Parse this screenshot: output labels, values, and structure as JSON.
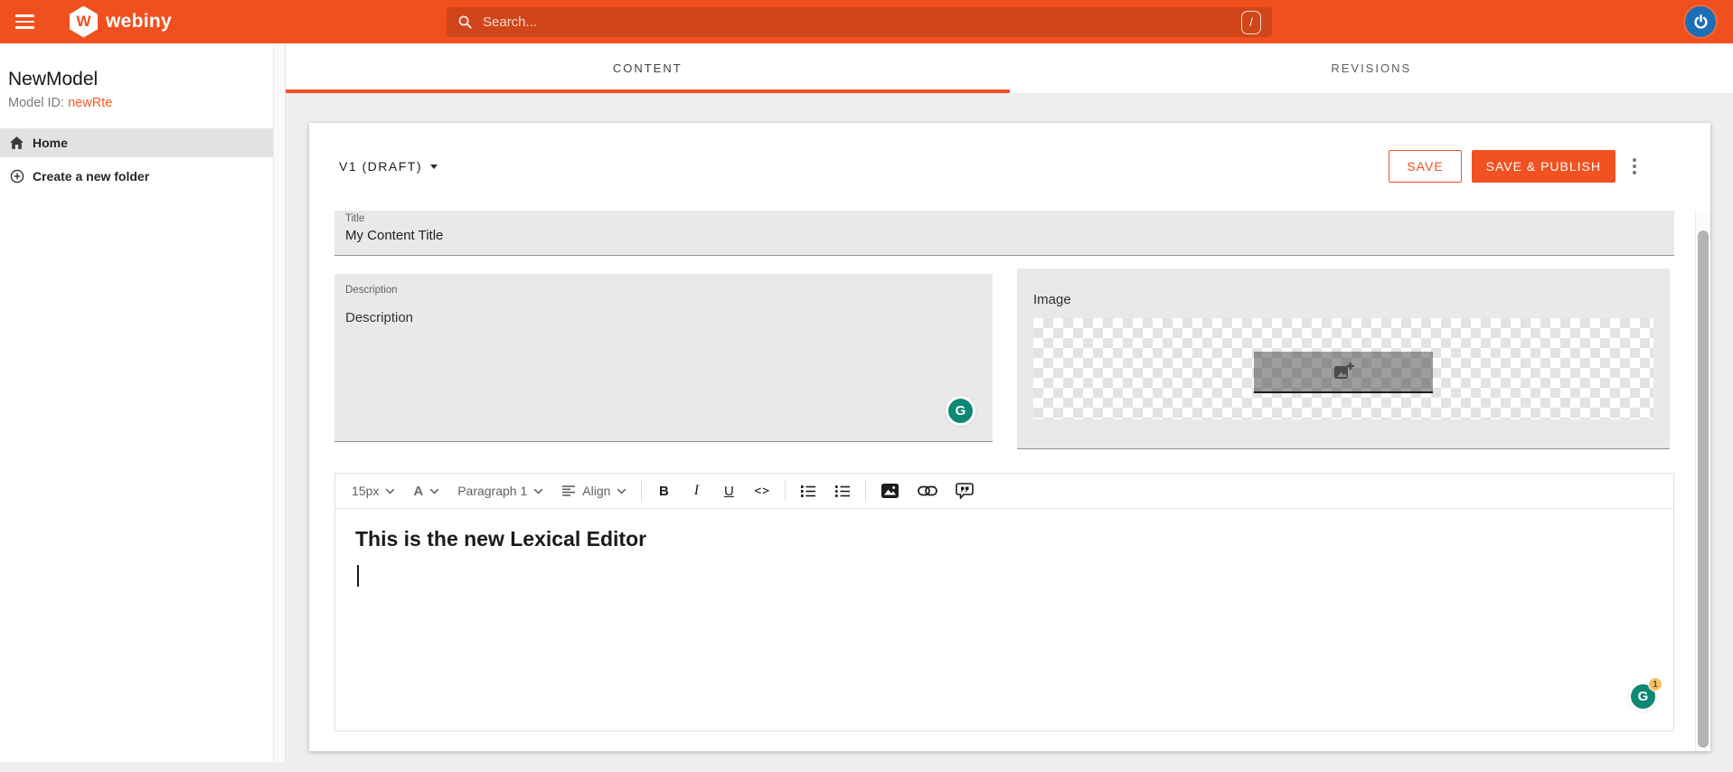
{
  "colors": {
    "accent_orange": "#f25122",
    "header_orange": "#f0501e",
    "avatar_blue": "#1b6fb5",
    "grammarly_green": "#0e8775",
    "badge_yellow": "#f3c268",
    "field_gray": "#e9e9e9"
  },
  "header": {
    "logo_letter": "W",
    "logo_text": "webiny",
    "search_placeholder": "Search...",
    "search_shortcut": "/"
  },
  "sidebar": {
    "title": "NewModel",
    "model_id_label": "Model ID:",
    "model_id_value": "newRte",
    "items": [
      {
        "label": "Home",
        "icon": "home-icon",
        "active": true
      },
      {
        "label": "Create a new folder",
        "icon": "circle-plus-icon",
        "active": false
      }
    ]
  },
  "tabs": [
    {
      "label": "CONTENT",
      "active": true
    },
    {
      "label": "REVISIONS",
      "active": false
    }
  ],
  "content": {
    "version_label": "V1 (DRAFT)",
    "buttons": {
      "save": "SAVE",
      "save_publish": "SAVE & PUBLISH"
    },
    "fields": {
      "title": {
        "label": "Title",
        "value": "My Content Title"
      },
      "description": {
        "label": "Description",
        "placeholder": "Description"
      },
      "image": {
        "label": "Image"
      }
    },
    "rte": {
      "toolbar": {
        "font_size": "15px",
        "font_color": "A",
        "paragraph_style": "Paragraph 1",
        "align": "Align",
        "bold": "B",
        "italic": "I",
        "underline": "U",
        "code": "<>"
      },
      "heading": "This is the new Lexical Editor",
      "grammarly_badge": "1"
    }
  }
}
